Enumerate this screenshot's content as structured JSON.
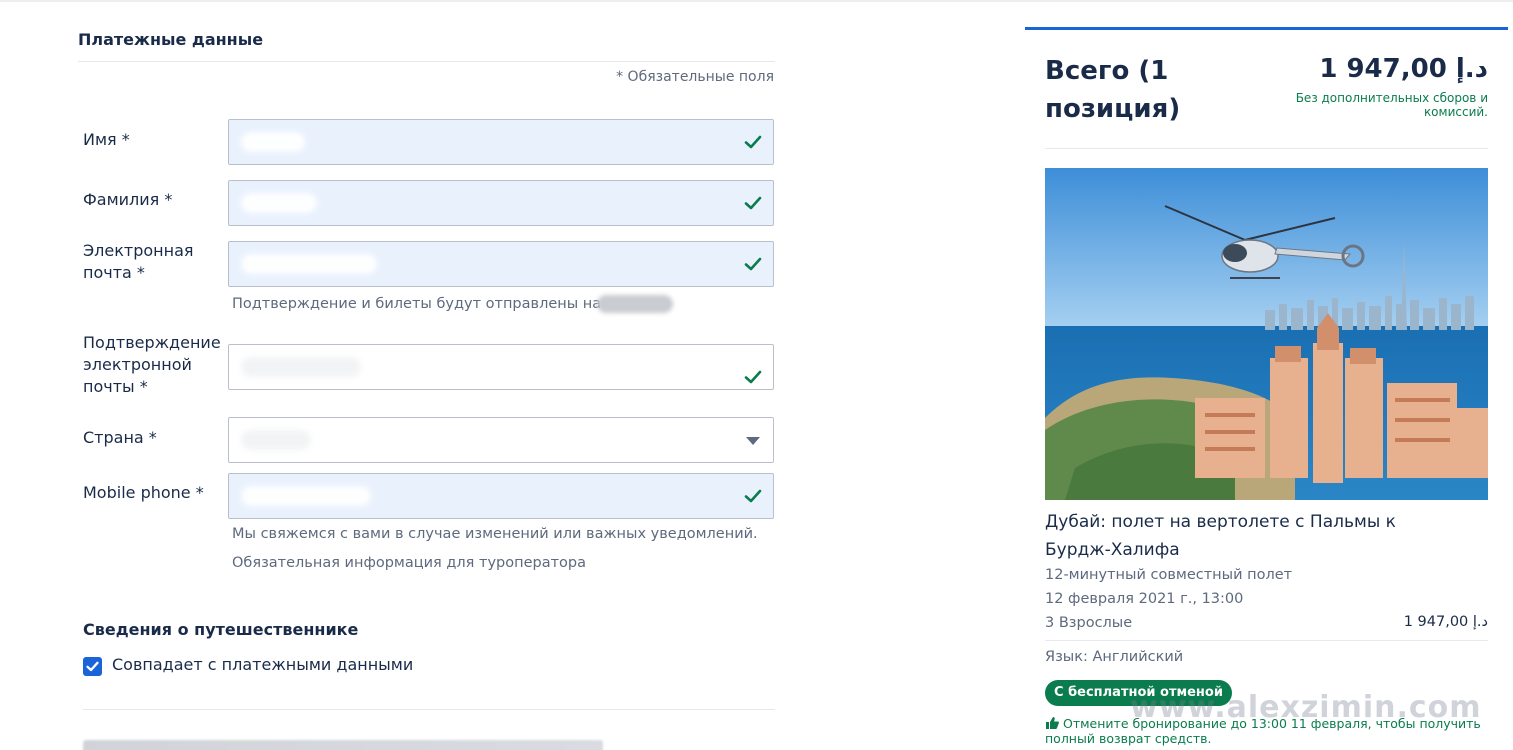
{
  "payment": {
    "section_title": "Платежные данные",
    "required_note": "* Обязательные поля",
    "first_name_label": "Имя *",
    "last_name_label": "Фамилия *",
    "email_label_line1": "Электронная",
    "email_label_line2": "почта *",
    "email_hint": "Подтверждение и билеты будут отправлены на",
    "confirm_email_label_line1": "Подтверждение",
    "confirm_email_label_line2": "электронной",
    "confirm_email_label_line3": "почты *",
    "country_label": "Страна *",
    "phone_label": "Mobile phone *",
    "phone_hint_1": "Мы свяжемся с вами в случае изменений или важных уведомлений.",
    "phone_hint_2": "Обязательная информация для туроператора"
  },
  "traveler": {
    "section_title": "Сведения о путешественнике",
    "same_as_payment_label": "Совпадает с платежными данными",
    "same_as_payment_checked": true
  },
  "summary": {
    "total_title": "Всего (1 позиция)",
    "total_price": "1 947,00 د.إ",
    "fee_note": "Без дополнительных сборов и комиссий.",
    "tour_title": "Дубай: полет на вертолете с Пальмы к Бурдж-Халифа",
    "tour_option": "12-минутный совместный полет",
    "tour_datetime": "12 февраля 2021 г., 13:00",
    "tour_participants": "3 Взрослые",
    "tour_participants_price": "1 947,00 د.إ",
    "tour_language": "Язык: Английский",
    "badge": "С бесплатной отменой",
    "cancel_note": "Отмените бронирование до 13:00 11 февраля, чтобы получить полный возврат средств."
  },
  "watermark": "www.alexzimin.com",
  "colors": {
    "accent_blue": "#1b64d8",
    "success_green": "#0a7c4d",
    "text_dark": "#1a2b49",
    "text_muted": "#5e6a7d",
    "field_fill": "#e9f1fd"
  },
  "icons": {
    "valid": "check-icon",
    "dropdown": "chevron-down-icon",
    "checkbox": "checkmark-icon",
    "thumb": "thumbs-up-icon"
  }
}
